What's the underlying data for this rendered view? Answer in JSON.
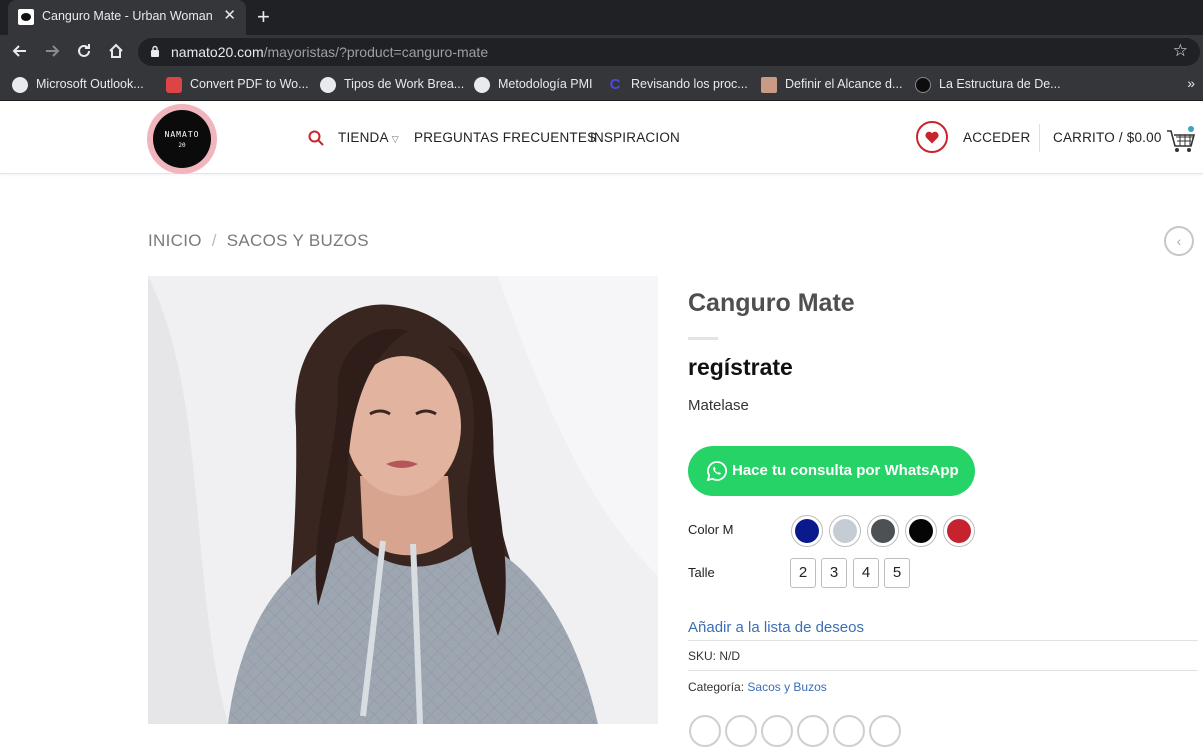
{
  "browser": {
    "tab_title": "Canguro Mate - Urban Woman",
    "tab_close": "✕",
    "new_tab": "+",
    "url_host": "namato20.com",
    "url_path": "/mayoristas/?product=canguro-mate",
    "bookmarks": [
      {
        "label": "Microsoft Outlook...",
        "icon": "globe-icon"
      },
      {
        "label": "Convert PDF to Wo...",
        "icon": "pdf-converter-icon"
      },
      {
        "label": "Tipos de Work Brea...",
        "icon": "globe-icon"
      },
      {
        "label": "Metodología PMI",
        "icon": "globe-icon"
      },
      {
        "label": "Revisando los proc...",
        "icon": "c-logo-icon"
      },
      {
        "label": "Definir el Alcance d...",
        "icon": "person-avatar-icon"
      },
      {
        "label": "La Estructura de De...",
        "icon": "pmi-logo-icon"
      }
    ],
    "bookmarks_more": "»"
  },
  "site": {
    "logo_text": "NAMATO",
    "logo_sub": "20",
    "nav": {
      "tienda": "TIENDA",
      "faq": "PREGUNTAS FRECUENTES",
      "inspiracion": "INSPIRACION"
    },
    "acceder": "ACCEDER",
    "cart": "CARRITO / $0.00"
  },
  "breadcrumb": {
    "home": "INICIO",
    "separator": "/",
    "category": "SACOS Y BUZOS"
  },
  "product": {
    "title": "Canguro Mate",
    "price_text": "regístrate",
    "short_description": "Matelase",
    "whatsapp_label": "Hace tu consulta por WhatsApp",
    "color_label": "Color M",
    "colors": [
      "#0a1a8c",
      "#c5ccd3",
      "#4d5156",
      "#050505",
      "#c4232f"
    ],
    "size_label": "Talle",
    "sizes": [
      "2",
      "3",
      "4",
      "5"
    ],
    "wishlist": "Añadir a la lista de deseos",
    "sku_label": "SKU:",
    "sku_value": "N/D",
    "category_label": "Categoría:",
    "category_value": "Sacos y Buzos"
  },
  "colors": {
    "accent_red": "#c9242c",
    "whatsapp_green": "#25d366",
    "link_blue": "#3b6fb6"
  }
}
